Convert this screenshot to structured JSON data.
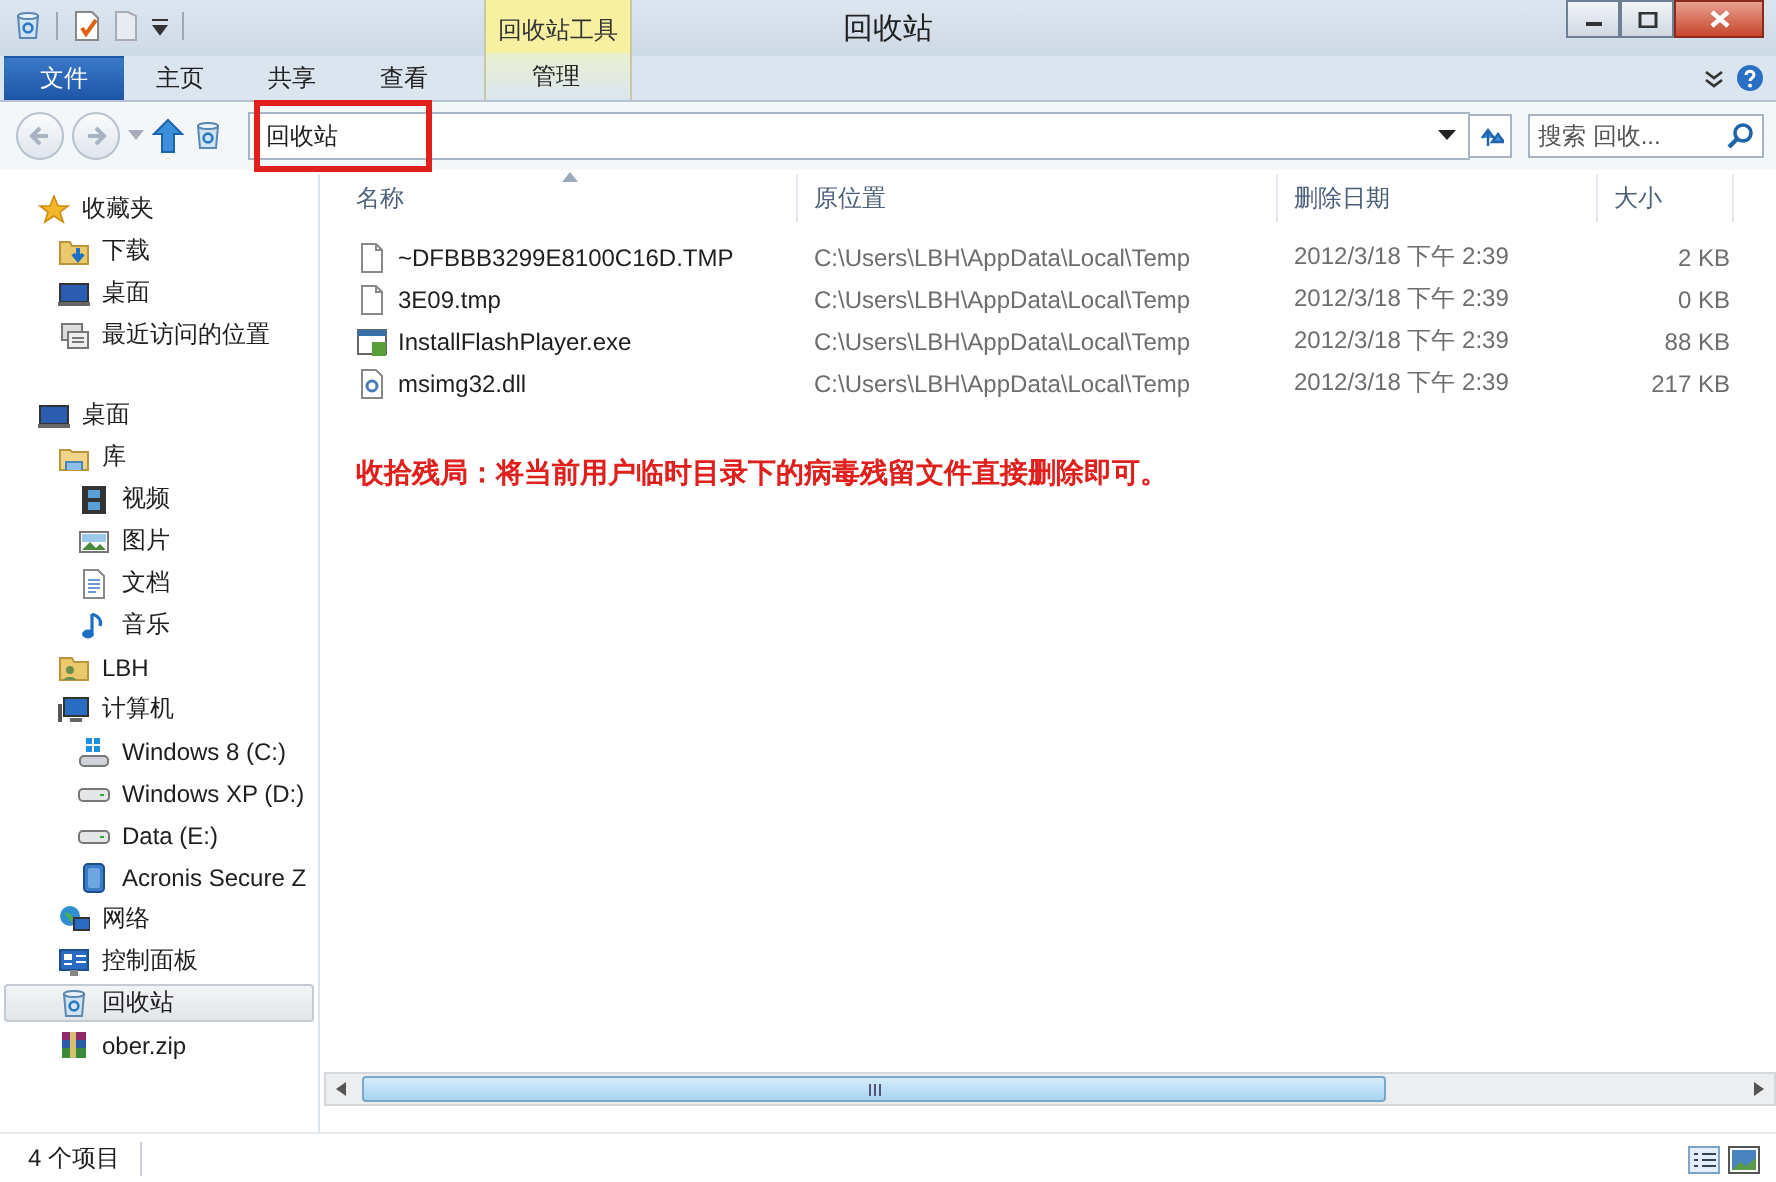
{
  "window": {
    "title": "回收站"
  },
  "ribbon": {
    "context_group": "回收站工具",
    "tabs": [
      {
        "label": "文件",
        "kind": "file",
        "selected": false
      },
      {
        "label": "主页",
        "kind": "tab",
        "selected": false
      },
      {
        "label": "共享",
        "kind": "tab",
        "selected": false
      },
      {
        "label": "查看",
        "kind": "tab",
        "selected": false
      },
      {
        "label": "管理",
        "kind": "context",
        "selected": false
      }
    ]
  },
  "address_bar": {
    "path": "回收站",
    "highlighted": true
  },
  "search": {
    "placeholder": "搜索 回收..."
  },
  "navigation": [
    {
      "label": "收藏夹",
      "kind": "star",
      "selected": false,
      "children": [
        {
          "label": "下载",
          "kind": "download",
          "selected": false
        },
        {
          "label": "桌面",
          "kind": "desktop",
          "selected": false
        },
        {
          "label": "最近访问的位置",
          "kind": "recent",
          "selected": false
        }
      ]
    },
    {
      "label": "桌面",
      "kind": "desktop",
      "selected": false,
      "children": [
        {
          "label": "库",
          "kind": "library",
          "selected": false,
          "children": [
            {
              "label": "视频",
              "kind": "video",
              "selected": false
            },
            {
              "label": "图片",
              "kind": "image",
              "selected": false
            },
            {
              "label": "文档",
              "kind": "document",
              "selected": false
            },
            {
              "label": "音乐",
              "kind": "music",
              "selected": false
            }
          ]
        },
        {
          "label": "LBH",
          "kind": "user",
          "selected": false
        },
        {
          "label": "计算机",
          "kind": "computer",
          "selected": false,
          "children": [
            {
              "label": "Windows 8 (C:)",
              "kind": "sysdrive",
              "selected": false
            },
            {
              "label": "Windows XP (D:)",
              "kind": "drive",
              "selected": false
            },
            {
              "label": "Data (E:)",
              "kind": "drive",
              "selected": false
            },
            {
              "label": "Acronis Secure Z",
              "kind": "secure",
              "selected": false
            }
          ]
        },
        {
          "label": "网络",
          "kind": "network",
          "selected": false
        },
        {
          "label": "控制面板",
          "kind": "control",
          "selected": false
        },
        {
          "label": "回收站",
          "kind": "recycle",
          "selected": true
        },
        {
          "label": "ober.zip",
          "kind": "archive",
          "selected": false
        }
      ]
    }
  ],
  "table": {
    "columns": [
      "名称",
      "原位置",
      "删除日期",
      "大小"
    ],
    "rows": [
      {
        "kind": "file",
        "name": "~DFBBB3299E8100C16D.TMP",
        "location": "C:\\Users\\LBH\\AppData\\Local\\Temp",
        "date": "2012/3/18 下午 2:39",
        "size": "2 KB"
      },
      {
        "kind": "file",
        "name": "3E09.tmp",
        "location": "C:\\Users\\LBH\\AppData\\Local\\Temp",
        "date": "2012/3/18 下午 2:39",
        "size": "0 KB"
      },
      {
        "kind": "exe",
        "name": "InstallFlashPlayer.exe",
        "location": "C:\\Users\\LBH\\AppData\\Local\\Temp",
        "date": "2012/3/18 下午 2:39",
        "size": "88 KB"
      },
      {
        "kind": "dll",
        "name": "msimg32.dll",
        "location": "C:\\Users\\LBH\\AppData\\Local\\Temp",
        "date": "2012/3/18 下午 2:39",
        "size": "217 KB"
      }
    ]
  },
  "annotation": "收拾残局：将当前用户临时目录下的病毒残留文件直接删除即可。",
  "status_bar": {
    "count": "4 个项目"
  }
}
